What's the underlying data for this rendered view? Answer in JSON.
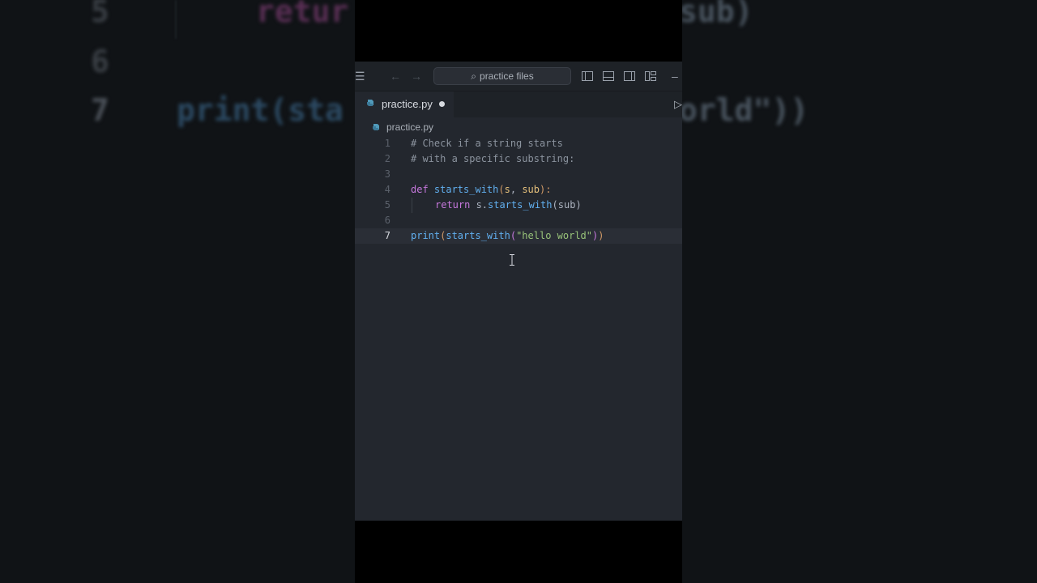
{
  "background": {
    "lines": [
      {
        "num": "5",
        "code": "retur",
        "right": "sub)"
      },
      {
        "num": "6"
      },
      {
        "num": "7",
        "code": "print(sta",
        "right": "orld\"))"
      }
    ]
  },
  "titlebar": {
    "search_placeholder": "practice files"
  },
  "tab": {
    "label": "practice.py"
  },
  "breadcrumb": {
    "file": "practice.py"
  },
  "editor": {
    "active_line": 7,
    "lines": [
      {
        "num": "1",
        "text": "# Check if a string starts"
      },
      {
        "num": "2",
        "text": "# with a specific substring:"
      },
      {
        "num": "3",
        "text": ""
      },
      {
        "num": "4",
        "kw": "def ",
        "fn": "starts_with",
        "p1": "(",
        "a1": "s",
        "c1": ", ",
        "a2": "sub",
        "p2": "):"
      },
      {
        "num": "5",
        "kw": "return ",
        "obj": "s.",
        "fn": "starts_with",
        "p1": "(",
        "arg": "sub",
        "p2": ")"
      },
      {
        "num": "6",
        "text": ""
      },
      {
        "num": "7",
        "fn1": "print",
        "p1": "(",
        "fn2": "starts_with",
        "b2": "(",
        "str": "\"hello world\"",
        "b2c": ")",
        "p1c": ")"
      }
    ]
  },
  "colors": {
    "editor_bg": "#23272e",
    "keyword": "#c678dd",
    "function": "#61afef",
    "string": "#98c379",
    "parameter": "#e5c07b"
  }
}
